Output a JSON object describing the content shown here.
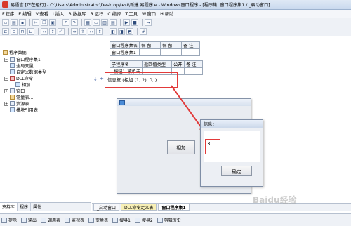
{
  "window": {
    "title": "易语言 [正在运行] - C:\\Users\\Administrator\\Desktop\\test\\新建 易程序.e - Windows窗口程序 - [程序集: 窗口程序集1 / _启动窗口]"
  },
  "menu": [
    "F.程序",
    "E.编辑",
    "V.查看",
    "I.插入",
    "B.数据库",
    "R.运行",
    "C.编译",
    "T.工具",
    "W.窗口",
    "H.帮助"
  ],
  "tree": {
    "root": "程序数据",
    "items": [
      "窗口程序集1",
      "全局变量",
      "自定义数据类型",
      "DLL命令",
      "相加",
      "窗口",
      "常量表...",
      "资源表",
      "模块引用表"
    ]
  },
  "left_tabs": [
    "支持库",
    "程序",
    "属性"
  ],
  "table_assembly": {
    "headers": [
      "窗口程序集名",
      "保 留",
      "保 留",
      "备 注"
    ],
    "row": [
      "窗口程序集1",
      "",
      "",
      ""
    ]
  },
  "table_sub": {
    "headers": [
      "子程序名",
      "返回值类型",
      "公开",
      "备 注"
    ],
    "row": [
      "_按钮1_被单击",
      "",
      "",
      ""
    ]
  },
  "code_line": "信息框 (相加 (1, 2), 0, )",
  "editor_tabs": [
    "_启动窗口",
    "DLL命令定义表",
    "窗口程序集1"
  ],
  "run_window": {
    "button_label": "相加"
  },
  "message_box": {
    "title": "信息：",
    "value": "3",
    "ok_label": "确定"
  },
  "bottom_bar": [
    "提示",
    "输出",
    "调用表",
    "监视表",
    "变量表",
    "搜寻1",
    "搜寻2",
    "剪辑历史"
  ],
  "watermark": "Baidu经验",
  "colors": {
    "highlight": "#e23a3a",
    "arrow": "#e23a3a"
  }
}
